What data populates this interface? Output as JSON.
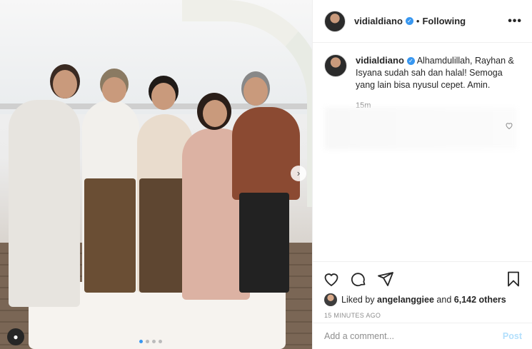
{
  "post": {
    "username": "vidialdiano",
    "verified_icon": "verified-badge-icon",
    "separator": "•",
    "follow_status": "Following",
    "more_label": "•••"
  },
  "caption": {
    "username": "vidialdiano",
    "text": "Alhamdulillah, Rayhan & Isyana sudah sah dan halal! Semoga yang lain bisa nyusul cepet. Amin.",
    "time": "15m"
  },
  "actions": {
    "like_icon": "heart-icon",
    "comment_icon": "comment-icon",
    "share_icon": "share-icon",
    "save_icon": "bookmark-icon"
  },
  "likes": {
    "prefix": "Liked by",
    "user": "angelanggiee",
    "and": "and",
    "others": "6,142 others"
  },
  "timestamp": "15 MINUTES AGO",
  "comment": {
    "placeholder": "Add a comment...",
    "post_label": "Post"
  },
  "carousel": {
    "count": 4,
    "active_index": 0
  },
  "colors": {
    "accent": "#3897f0",
    "post_disabled": "#b2dffc"
  }
}
